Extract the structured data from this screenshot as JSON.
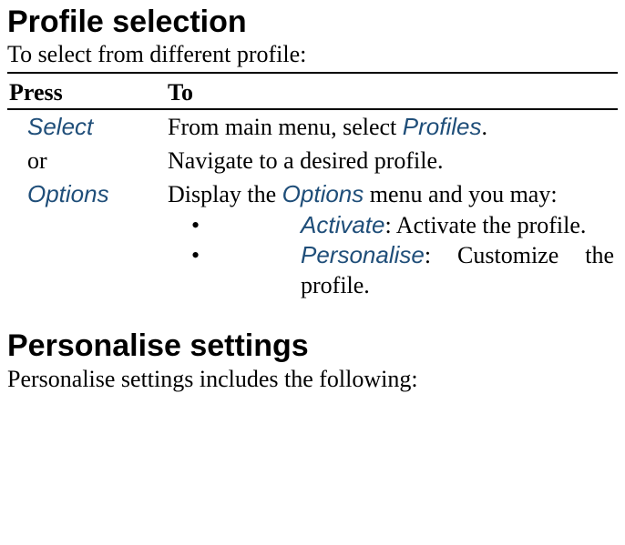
{
  "section1": {
    "title": "Profile selection",
    "subtitle": "To select from different profile:"
  },
  "table": {
    "header": {
      "press": "Press",
      "to": "To"
    },
    "rows": {
      "r0": {
        "press": "Select",
        "to_before": "From main menu, select ",
        "to_link": "Profiles",
        "to_after": "."
      },
      "r1": {
        "press": "or",
        "to": "Navigate to a desired profile."
      },
      "r2": {
        "press": "Options",
        "to_before": "Display the ",
        "to_link": "Options",
        "to_after": " menu and you may:",
        "items": {
          "i0": {
            "link": "Activate",
            "rest": ": Activate the profile."
          },
          "i1": {
            "link": "Personalise",
            "rest": ": Customize the profile."
          }
        }
      }
    }
  },
  "section2": {
    "title": "Personalise settings",
    "subtitle": "Personalise settings includes the following:"
  }
}
